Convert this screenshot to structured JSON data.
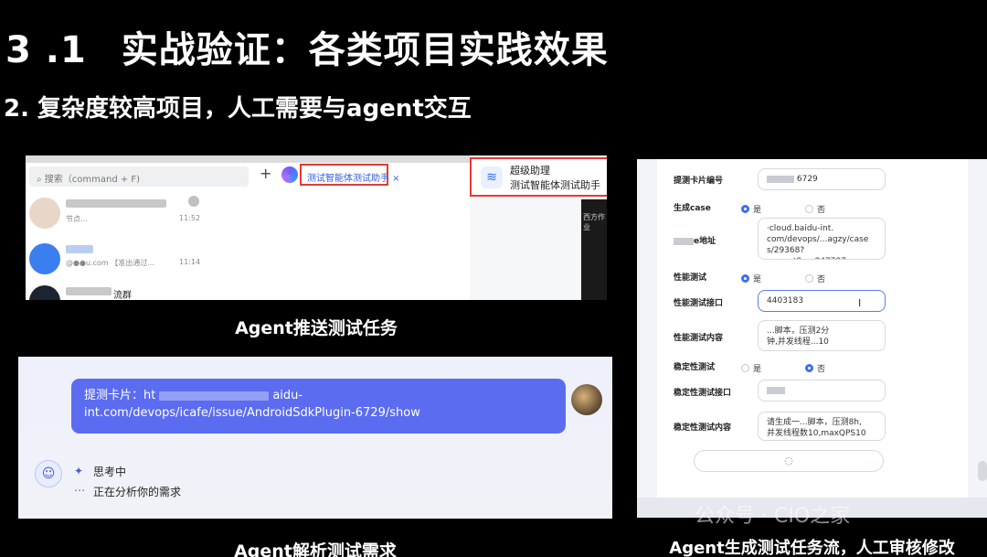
{
  "slide": {
    "section_number": "3 .1",
    "title": "实战验证：各类项目实践效果",
    "subtitle": "2. 复杂度较高项目，人工需要与agent交互"
  },
  "panel_a": {
    "caption": "Agent推送测试任务",
    "search_placeholder": "搜索（command + F)",
    "tab_label": "测试智能体测试助手 ×",
    "assistant_name": "超级助理",
    "assistant_desc": "测试智能体测试助手",
    "side_tag": "西方作业",
    "chats": [
      {
        "name_visible": "",
        "preview": "节点...",
        "time": "11:52"
      },
      {
        "name_visible": "",
        "preview": "@●●u.com 【准出通过...",
        "time": "11:14"
      },
      {
        "name_visible": "流群",
        "preview": "",
        "time": ""
      }
    ]
  },
  "panel_b": {
    "caption": "Agent解析测试需求",
    "message_prefix": "提测卡片：ht",
    "message_visible": "aidu-int.com/devops/icafe/issue/AndroidSdkPlugin-6729/show",
    "thinking_label": "思考中",
    "status_text": "正在分析你的需求",
    "bot_icon": "robot-icon",
    "sparkle_icon": "sparkle-icon"
  },
  "panel_c": {
    "caption": "Agent生成测试任务流，人工审核修改",
    "fields": {
      "card_id_label": "提测卡片编号",
      "card_id_value": "6729",
      "gen_case_label": "生成case",
      "addr_label": "e地址",
      "addr_value": "·cloud.baidu-int.\ncom/devops/...agzy/case\ns/29368?currentSu...847787",
      "perf_label": "性能测试",
      "perf_iface_label": "性能测试接口",
      "perf_iface_value": "4403183",
      "perf_content_label": "性能测试内容",
      "perf_content_value": "...脚本，压测2分\n钟,并发线程...10",
      "stab_label": "稳定性测试",
      "stab_iface_label": "稳定性测试接口",
      "stab_content_label": "稳定性测试内容",
      "stab_content_value": "请生成一...脚本，压测8h,\n并发线程数10,maxQPS10"
    },
    "radio_yes": "是",
    "radio_no": "否",
    "gen_case_choice": "是",
    "perf_choice": "是",
    "stab_choice": "否",
    "loading_icon": "spinner-icon"
  },
  "watermark": "公众号 · CIO之家",
  "colors": {
    "accent_red": "#e53935",
    "bubble": "#5b6cf0",
    "radio": "#3b6ef0"
  }
}
